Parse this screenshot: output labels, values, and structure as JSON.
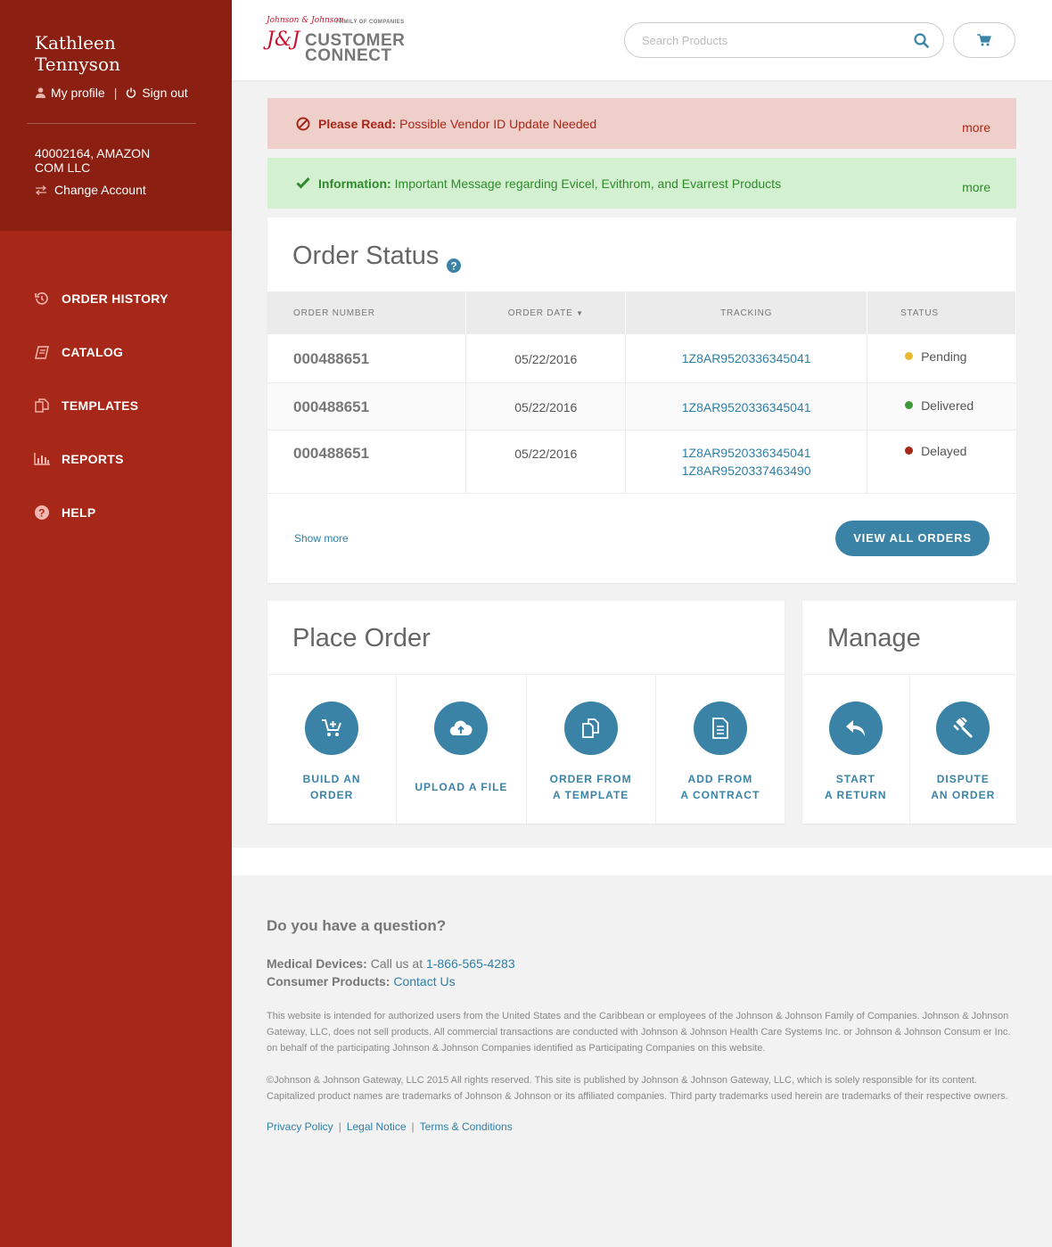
{
  "user": {
    "name": "Kathleen Tennyson",
    "my_profile": "My profile",
    "sign_out": "Sign out",
    "account": "40002164, AMAZON COM LLC",
    "change_account": "Change Account"
  },
  "nav": {
    "items": [
      {
        "label": "ORDER HISTORY",
        "icon": "history-icon"
      },
      {
        "label": "CATALOG",
        "icon": "book-icon"
      },
      {
        "label": "TEMPLATES",
        "icon": "templates-icon"
      },
      {
        "label": "REPORTS",
        "icon": "bar-chart-icon"
      },
      {
        "label": "HELP",
        "icon": "help-icon"
      }
    ]
  },
  "header": {
    "logo_brand": "Johnson & Johnson",
    "logo_family": "FAMILY OF COMPANIES",
    "logo_jj": "J&J",
    "logo_line1": "CUSTOMER",
    "logo_line2": "CONNECT",
    "search_placeholder": "Search Products"
  },
  "alerts": {
    "vendor": {
      "title": "Please Read:",
      "text": "Possible Vendor ID Update Needed",
      "more": "more"
    },
    "info": {
      "title": "Information:",
      "text": "Important Message regarding Evicel, Evithrom, and Evarrest Products",
      "more": "more"
    }
  },
  "order_status": {
    "title": "Order Status",
    "columns": {
      "number": "ORDER NUMBER",
      "date": "ORDER DATE",
      "tracking": "TRACKING",
      "status": "STATUS"
    },
    "rows": [
      {
        "number": "000488651",
        "date": "05/22/2016",
        "tracking": [
          "1Z8AR9520336345041"
        ],
        "status": "Pending",
        "status_color": "#e6b92e"
      },
      {
        "number": "000488651",
        "date": "05/22/2016",
        "tracking": [
          "1Z8AR9520336345041"
        ],
        "status": "Delivered",
        "status_color": "#3f9a3c"
      },
      {
        "number": "000488651",
        "date": "05/22/2016",
        "tracking": [
          "1Z8AR9520336345041",
          "1Z8AR9520337463490"
        ],
        "status": "Delayed",
        "status_color": "#a72718"
      }
    ],
    "show_more": "Show more",
    "view_all": "VIEW ALL ORDERS"
  },
  "place_order": {
    "title": "Place Order",
    "actions": [
      {
        "line1": "BUILD AN",
        "line2": "ORDER",
        "icon": "cart-plus-icon"
      },
      {
        "line1": "UPLOAD A FILE",
        "line2": "",
        "icon": "cloud-upload-icon"
      },
      {
        "line1": "ORDER FROM",
        "line2": "A TEMPLATE",
        "icon": "copy-icon"
      },
      {
        "line1": "ADD FROM",
        "line2": "A CONTRACT",
        "icon": "document-icon"
      }
    ]
  },
  "manage": {
    "title": "Manage",
    "actions": [
      {
        "line1": "START",
        "line2": "A RETURN",
        "icon": "reply-icon"
      },
      {
        "line1": "DISPUTE",
        "line2": "AN ORDER",
        "icon": "gavel-icon"
      }
    ]
  },
  "footer": {
    "question": "Do you have a question?",
    "medical_label": "Medical Devices:",
    "medical_text": "Call us at",
    "medical_phone": "1-866-565-4283",
    "consumer_label": "Consumer Products:",
    "consumer_link": "Contact Us",
    "legal1": "This website is intended for authorized users from the United States and the Caribbean or employees of the Johnson & Johnson Family of Companies. Johnson & Johnson Gateway, LLC, does not sell products. All commercial transactions are conducted with Johnson & Johnson Health Care Systems Inc. or Johnson & Johnson Consum er Inc. on behalf of the participating Johnson & Johnson Companies identified as Participating Companies on this website.",
    "legal2": "©Johnson & Johnson Gateway, LLC 2015 All rights reserved. This site is published by Johnson & Johnson Gateway, LLC, which is solely responsible for its content. Capitalized product names are trademarks of Johnson & Johnson or its affiliated companies. Third party trademarks used herein are trademarks of their respective owners.",
    "links": [
      "Privacy Policy",
      "Legal Notice",
      "Terms & Conditions"
    ]
  },
  "colors": {
    "sidebar": "#a72718",
    "sidebar_top": "#8a1f12",
    "accent": "#3a83a6",
    "link": "#2e7fa7"
  }
}
